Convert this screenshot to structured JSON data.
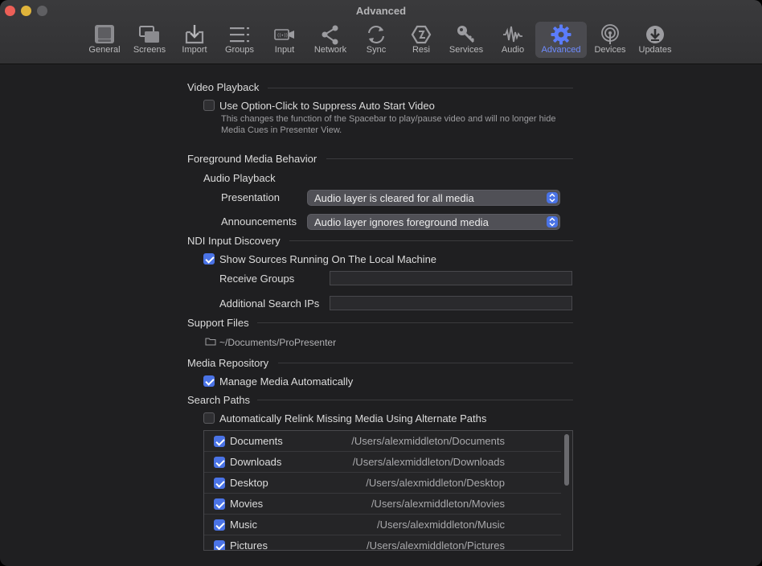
{
  "window": {
    "title": "Advanced"
  },
  "toolbar": {
    "items": [
      {
        "label": "General",
        "icon": "general-icon"
      },
      {
        "label": "Screens",
        "icon": "screens-icon"
      },
      {
        "label": "Import",
        "icon": "import-icon"
      },
      {
        "label": "Groups",
        "icon": "groups-icon"
      },
      {
        "label": "Input",
        "icon": "input-icon"
      },
      {
        "label": "Network",
        "icon": "network-icon"
      },
      {
        "label": "Sync",
        "icon": "sync-icon"
      },
      {
        "label": "Resi",
        "icon": "resi-icon"
      },
      {
        "label": "Services",
        "icon": "services-key-icon"
      },
      {
        "label": "Audio",
        "icon": "audio-waveform-icon"
      },
      {
        "label": "Advanced",
        "icon": "advanced-gear-icon",
        "active": true
      },
      {
        "label": "Devices",
        "icon": "devices-icon"
      },
      {
        "label": "Updates",
        "icon": "updates-icon"
      }
    ],
    "accent_color": "#6f8cff"
  },
  "video_playback": {
    "title": "Video Playback",
    "option_click_label": "Use Option-Click to Suppress Auto Start Video",
    "option_click_checked": false,
    "option_click_desc": "This changes the function of the Spacebar to play/pause video and will no longer hide Media Cues in Presenter View."
  },
  "foreground_media": {
    "title": "Foreground Media Behavior",
    "audio_playback_title": "Audio Playback",
    "presentation_label": "Presentation",
    "presentation_value": "Audio layer is cleared for all media",
    "announcements_label": "Announcements",
    "announcements_value": "Audio layer ignores foreground media"
  },
  "ndi": {
    "title": "NDI Input Discovery",
    "show_sources_label": "Show Sources Running On The Local Machine",
    "show_sources_checked": true,
    "receive_groups_label": "Receive Groups",
    "receive_groups_value": "",
    "additional_ips_label": "Additional Search IPs",
    "additional_ips_value": ""
  },
  "support_files": {
    "title": "Support Files",
    "path": "~/Documents/ProPresenter"
  },
  "media_repository": {
    "title": "Media Repository",
    "manage_label": "Manage Media Automatically",
    "manage_checked": true
  },
  "search_paths": {
    "title": "Search Paths",
    "relink_label": "Automatically Relink Missing Media Using Alternate Paths",
    "relink_checked": false,
    "rows": [
      {
        "name": "Documents",
        "path": "/Users/alexmiddleton/Documents",
        "checked": true
      },
      {
        "name": "Downloads",
        "path": "/Users/alexmiddleton/Downloads",
        "checked": true
      },
      {
        "name": "Desktop",
        "path": "/Users/alexmiddleton/Desktop",
        "checked": true
      },
      {
        "name": "Movies",
        "path": "/Users/alexmiddleton/Movies",
        "checked": true
      },
      {
        "name": "Music",
        "path": "/Users/alexmiddleton/Music",
        "checked": true
      },
      {
        "name": "Pictures",
        "path": "/Users/alexmiddleton/Pictures",
        "checked": true
      }
    ]
  },
  "colors": {
    "checkbox_checked": "#4a73e6",
    "background": "#1f1f21"
  }
}
